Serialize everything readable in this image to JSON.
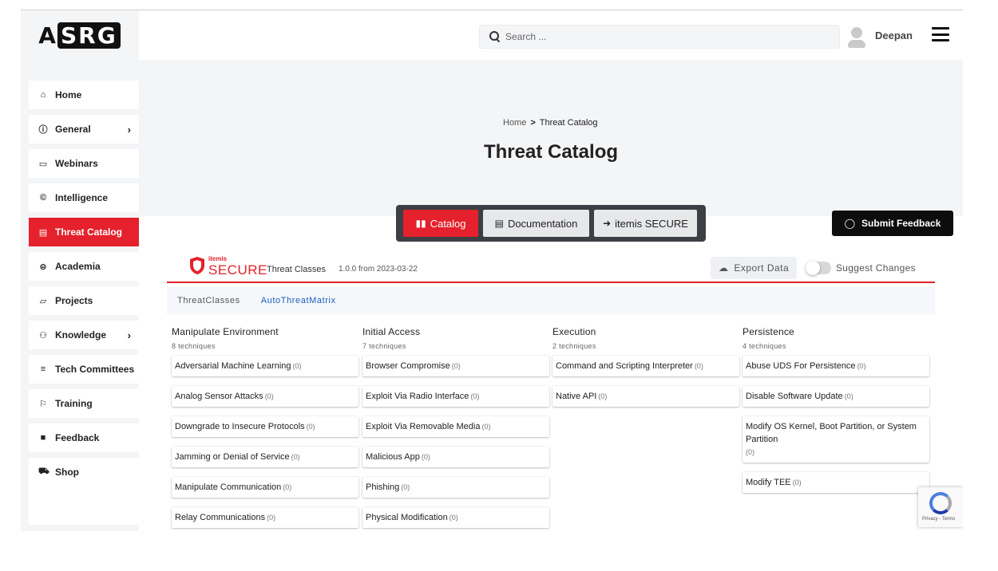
{
  "header": {
    "logo_text_left": "A",
    "logo_text_box": "SRG",
    "search_placeholder": "Search ...",
    "username": "Deepan"
  },
  "sidebar": {
    "items": [
      {
        "label": "Home",
        "icon": "home-icon",
        "glyph": "⌂",
        "has_chevron": false,
        "active": false
      },
      {
        "label": "General",
        "icon": "info-icon",
        "glyph": "ⓘ",
        "has_chevron": true,
        "active": false
      },
      {
        "label": "Webinars",
        "icon": "monitor-icon",
        "glyph": "▭",
        "has_chevron": false,
        "active": false
      },
      {
        "label": "Intelligence",
        "icon": "copyright-icon",
        "glyph": "©",
        "has_chevron": false,
        "active": false
      },
      {
        "label": "Threat Catalog",
        "icon": "document-icon",
        "glyph": "▤",
        "has_chevron": false,
        "active": true
      },
      {
        "label": "Academia",
        "icon": "graduation-icon",
        "glyph": "⊜",
        "has_chevron": false,
        "active": false
      },
      {
        "label": "Projects",
        "icon": "folder-icon",
        "glyph": "▱",
        "has_chevron": false,
        "active": false
      },
      {
        "label": "Knowledge",
        "icon": "people-icon",
        "glyph": "⚇",
        "has_chevron": true,
        "active": false
      },
      {
        "label": "Tech Committees",
        "icon": "list-icon",
        "glyph": "≡",
        "has_chevron": false,
        "active": false
      },
      {
        "label": "Training",
        "icon": "training-icon",
        "glyph": "⚐",
        "has_chevron": false,
        "active": false
      },
      {
        "label": "Feedback",
        "icon": "chat-icon",
        "glyph": "■",
        "has_chevron": false,
        "active": false
      },
      {
        "label": "Shop",
        "icon": "cart-icon",
        "glyph": "⛟",
        "has_chevron": false,
        "active": false
      }
    ],
    "chevron": "›"
  },
  "breadcrumb": {
    "home": "Home",
    "separator": ">",
    "current": "Threat Catalog"
  },
  "page_title": "Threat Catalog",
  "tabs": [
    {
      "label": "Catalog",
      "icon": "book-icon",
      "glyph": "📖",
      "active": true
    },
    {
      "label": "Documentation",
      "icon": "list-icon",
      "glyph": "▤",
      "active": false
    },
    {
      "label": "itemis SECURE",
      "icon": "arrow-circle-icon",
      "glyph": "➜",
      "active": false
    }
  ],
  "feedback_button": {
    "label": "Submit Feedback",
    "icon": "chat-icon"
  },
  "secure": {
    "logo_small": "itemis",
    "logo": "SECURE",
    "classes_label": "Threat Classes",
    "version": "1.0.0 from 2023-03-22",
    "export_label": "Export Data",
    "suggest_label": "Suggest Changes",
    "suggest_enabled": false
  },
  "subtabs": [
    {
      "label": "ThreatClasses",
      "active": false
    },
    {
      "label": "AutoThreatMatrix",
      "active": true
    }
  ],
  "columns": [
    {
      "title": "Manipulate Environment",
      "count": "8 techniques",
      "techniques": [
        {
          "name": "Adversarial Machine Learning",
          "count": "(0)"
        },
        {
          "name": "Analog Sensor Attacks",
          "count": "(0)"
        },
        {
          "name": "Downgrade to Insecure Protocols",
          "count": "(0)"
        },
        {
          "name": "Jamming or Denial of Service",
          "count": "(0)"
        },
        {
          "name": "Manipulate Communication",
          "count": "(0)"
        },
        {
          "name": "Relay Communications",
          "count": "(0)"
        }
      ]
    },
    {
      "title": "Initial Access",
      "count": "7 techniques",
      "techniques": [
        {
          "name": "Browser Compromise",
          "count": "(0)"
        },
        {
          "name": "Exploit Via Radio Interface",
          "count": "(0)"
        },
        {
          "name": "Exploit Via Removable Media",
          "count": "(0)"
        },
        {
          "name": "Malicious App",
          "count": "(0)"
        },
        {
          "name": "Phishing",
          "count": "(0)"
        },
        {
          "name": "Physical Modification",
          "count": "(0)"
        }
      ]
    },
    {
      "title": "Execution",
      "count": "2 techniques",
      "techniques": [
        {
          "name": "Command and Scripting Interpreter",
          "count": "(0)"
        },
        {
          "name": "Native API",
          "count": "(0)"
        }
      ]
    },
    {
      "title": "Persistence",
      "count": "4 techniques",
      "techniques": [
        {
          "name": "Abuse UDS For Persistence",
          "count": "(0)"
        },
        {
          "name": "Disable Software Update",
          "count": "(0)"
        },
        {
          "name": "Modify OS Kernel, Boot Partition, or System Partition",
          "count": "(0)",
          "multiline": true
        },
        {
          "name": "Modify TEE",
          "count": "(0)"
        }
      ]
    }
  ],
  "recaptcha": {
    "text": "Privacy - Terms"
  },
  "colors": {
    "accent": "#e4212c",
    "link": "#1a5fbf",
    "dark": "#0d0d0d"
  }
}
